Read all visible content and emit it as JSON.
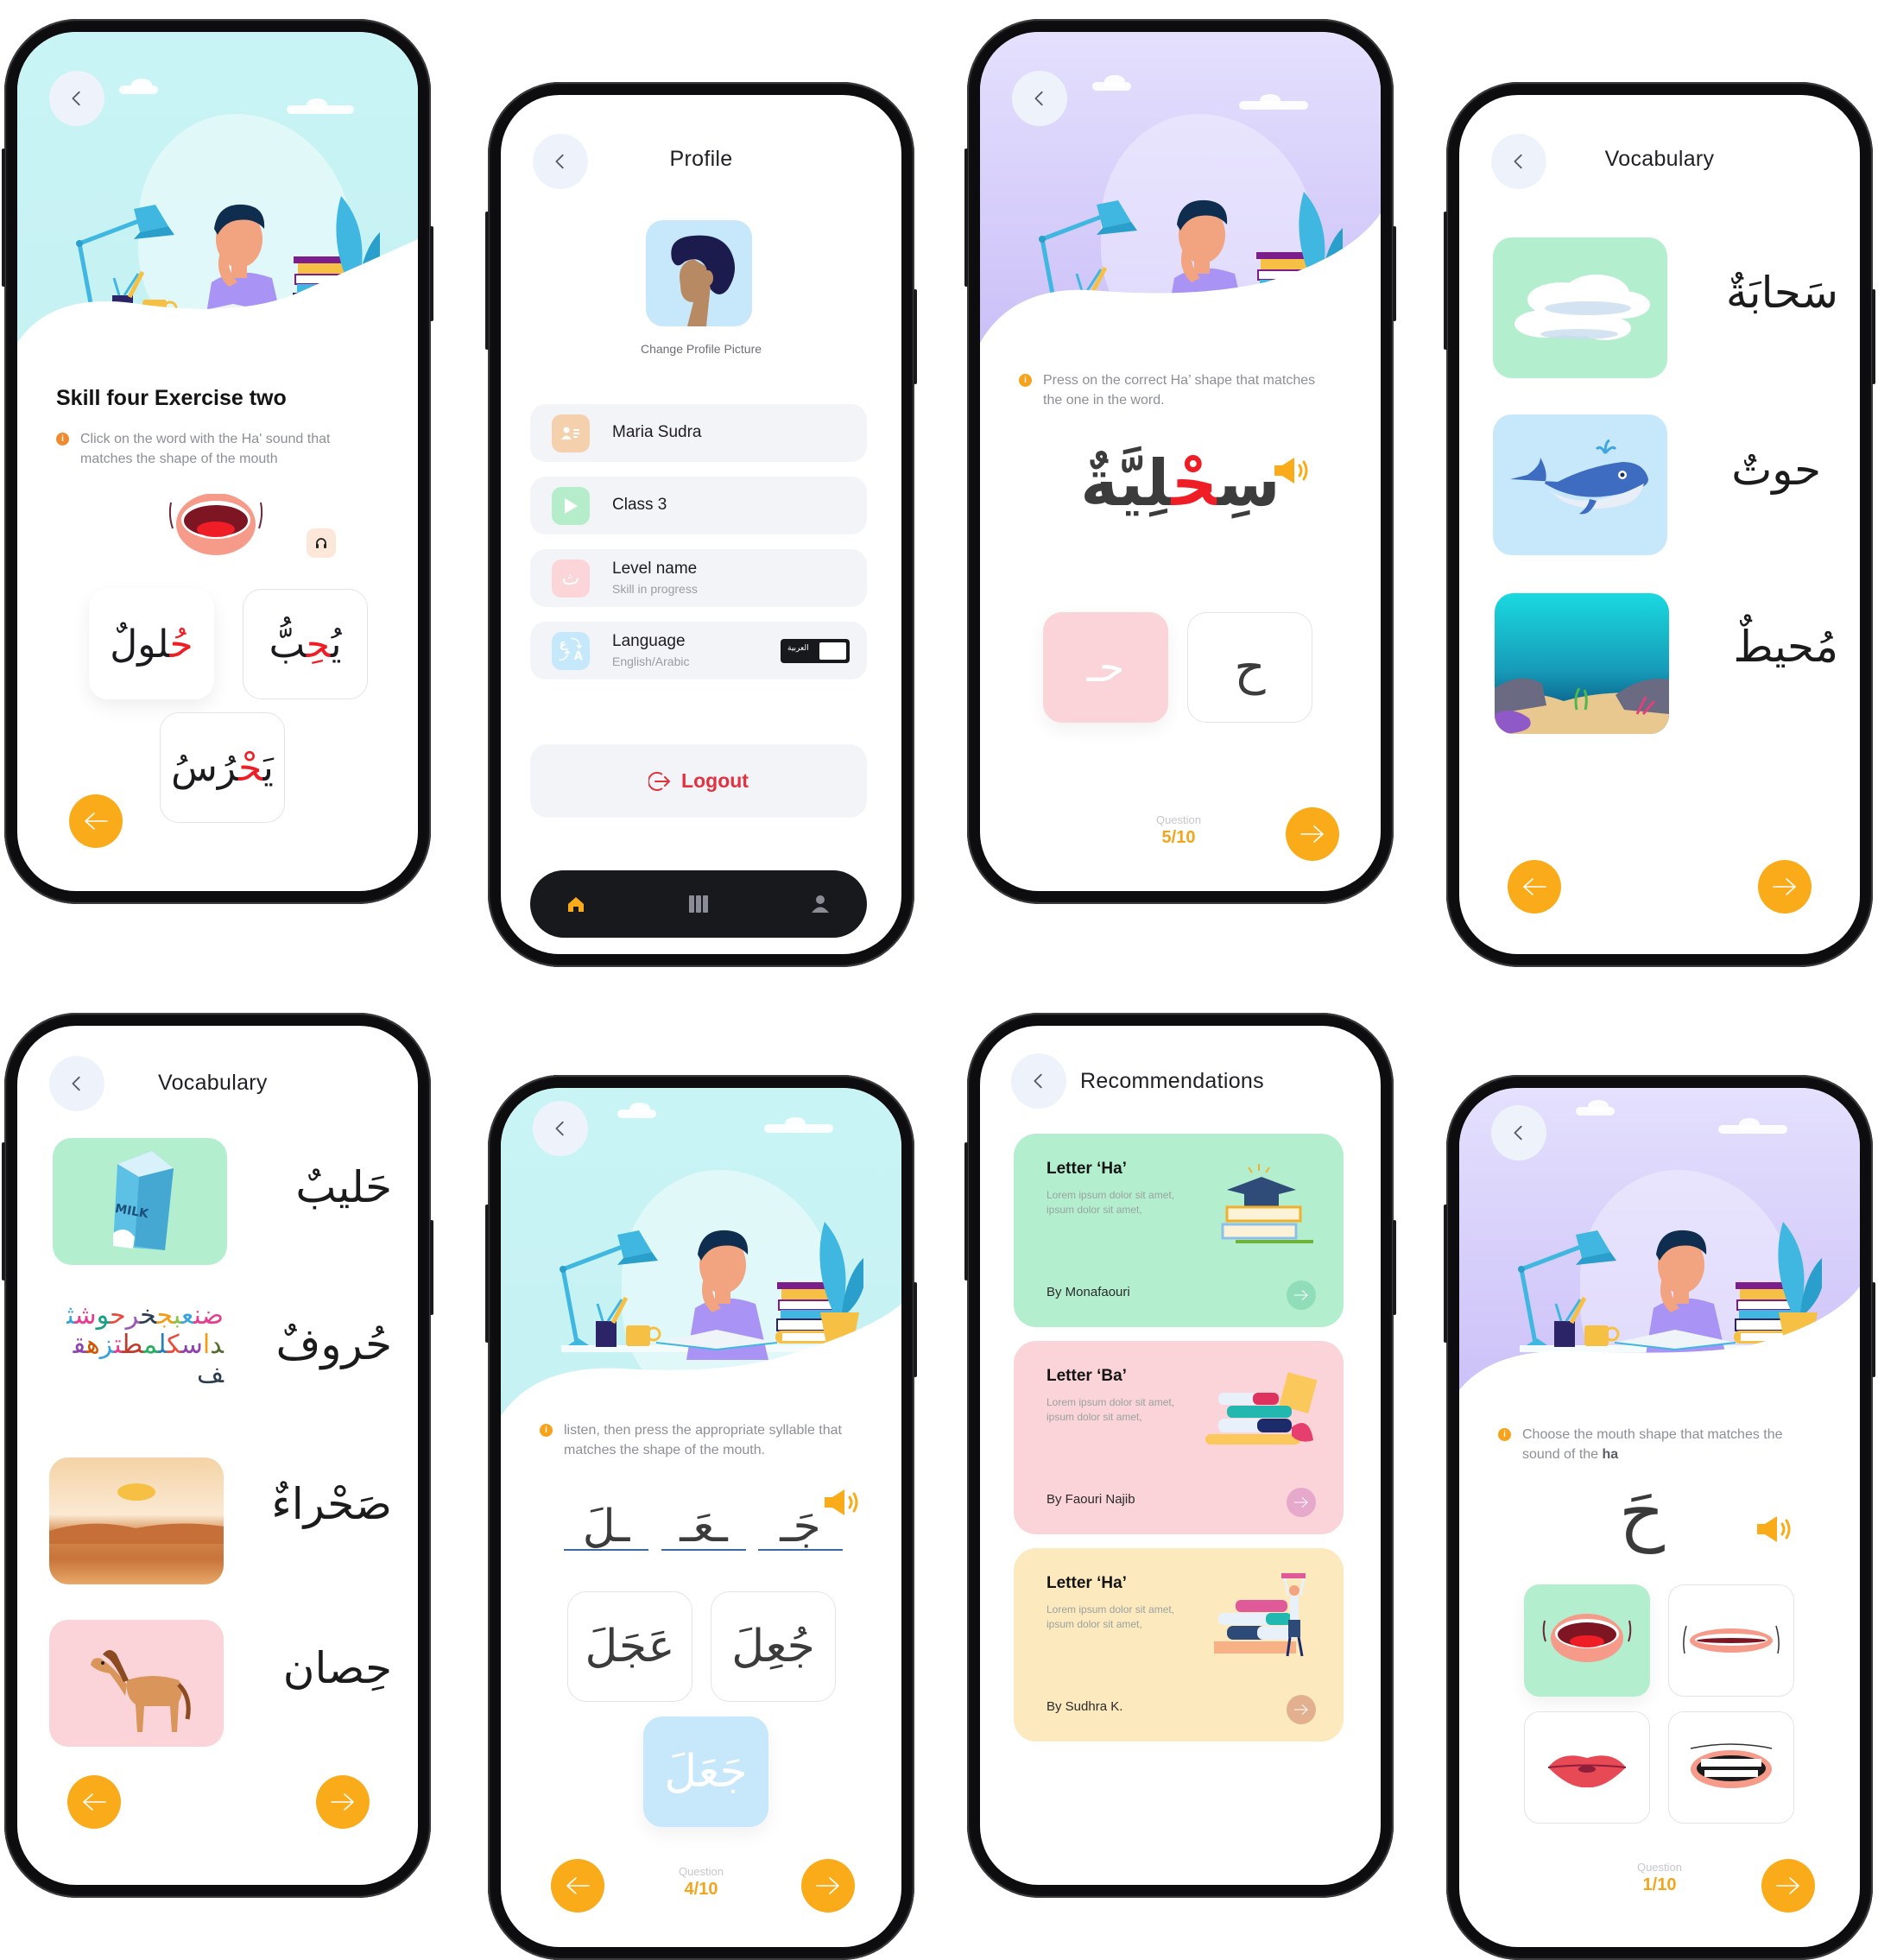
{
  "common": {
    "back_icon": "chevron-left-icon",
    "prev_icon": "arrow-left-icon",
    "next_icon": "arrow-right-icon",
    "speaker_icon": "speaker-icon",
    "info_icon": "info-icon",
    "question_label": "Question",
    "accent_color": "#F9AB1A",
    "highlight_letter_color": "#EF1D25"
  },
  "exercise_words": {
    "title": "Skill four Exercise two",
    "instruction": "Click on the word with the Ha' sound that matches the shape of the mouth",
    "audio_icon": "headphones-icon",
    "mouth_image": "open-mouth-illustration",
    "words": [
      {
        "prefix": "",
        "highlight": "حُ",
        "suffix": "لولٌ"
      },
      {
        "prefix": "يُ",
        "highlight": "حِ",
        "suffix": "بُّ"
      },
      {
        "prefix": "يَ",
        "highlight": "حْ",
        "suffix": "رُسُ"
      }
    ]
  },
  "profile": {
    "title": "Profile",
    "change_picture": "Change Profile Picture",
    "rows": [
      {
        "icon": "contact-card-icon",
        "label": "Maria Sudra",
        "sub": ""
      },
      {
        "icon": "play-icon",
        "label": "Class 3",
        "sub": ""
      },
      {
        "icon": "arabic-letter-icon",
        "label": "Level name",
        "sub": "Skill in progress"
      },
      {
        "icon": "translate-icon",
        "label": "Language",
        "sub": "English/Arabic"
      }
    ],
    "language_toggle_label": "العربية",
    "logout": "Logout",
    "tabs": [
      {
        "name": "home",
        "icon": "home-icon",
        "active": true
      },
      {
        "name": "library",
        "icon": "library-icon",
        "active": false
      },
      {
        "name": "profile",
        "icon": "user-icon",
        "active": false
      }
    ]
  },
  "exercise_shape": {
    "instruction": "Press on the correct Ha’ shape that matches the one in the word.",
    "word": {
      "prefix": "سِ",
      "highlight": "حْ",
      "suffix": "لِيَّةٌ"
    },
    "options": [
      {
        "glyph": "حـ",
        "state": "selected-wrong"
      },
      {
        "glyph": "ح",
        "state": "default"
      }
    ],
    "question": "5/10"
  },
  "vocab_a": {
    "title": "Vocabulary",
    "items": [
      {
        "word": "سَحابَةٌ",
        "image": "clouds"
      },
      {
        "word": "حوتٌ",
        "image": "whale"
      },
      {
        "word": "مُحيطٌ",
        "image": "ocean"
      }
    ]
  },
  "vocab_b": {
    "title": "Vocabulary",
    "items": [
      {
        "word": "حَليبٌ",
        "image": "milk-carton"
      },
      {
        "word": "حُروفٌ",
        "image": "arabic-letters"
      },
      {
        "word": "صَحْراءٌ",
        "image": "desert"
      },
      {
        "word": "حِصان",
        "image": "horse"
      }
    ]
  },
  "exercise_syllables": {
    "instruction": "listen, then press the appropriate syllable that matches the shape of the mouth.",
    "syllables": [
      "جَـ",
      "ـعَـ",
      "ـلَ"
    ],
    "options": [
      {
        "word": "جُعِلَ",
        "state": "default"
      },
      {
        "word": "عَجَلَ",
        "state": "default"
      },
      {
        "word": "جَعَلَ",
        "state": "selected"
      }
    ],
    "question": "4/10"
  },
  "recommendations": {
    "title": "Recommendations",
    "cards": [
      {
        "title": "Letter ‘Ha’",
        "desc": "Lorem ipsum dolor sit amet, ipsum dolor sit amet,",
        "author": "By Monafaouri",
        "bg": "#B3EFCF",
        "btn": "#8FDDB9",
        "image": "graduation-books"
      },
      {
        "title": "Letter ‘Ba’",
        "desc": "Lorem ipsum dolor sit amet, ipsum dolor sit amet,",
        "author": "By Faouri Najib",
        "bg": "#FAD4D8",
        "btn": "#E6A9CC",
        "image": "book-stack"
      },
      {
        "title": "Letter ‘Ha’",
        "desc": "Lorem ipsum dolor sit amet, ipsum dolor sit amet,",
        "author": "By Sudhra K.",
        "bg": "#FDE9BE",
        "btn": "#E2B08F",
        "image": "student-books"
      }
    ]
  },
  "exercise_mouth": {
    "instruction_prefix": "Choose the mouth shape that matches the sound of the ",
    "instruction_bold": "ha",
    "letter": "حَ",
    "options": [
      {
        "image": "wide-open-mouth",
        "state": "selected"
      },
      {
        "image": "smile-mouth",
        "state": "default"
      },
      {
        "image": "closed-lips",
        "state": "default"
      },
      {
        "image": "teeth-mouth",
        "state": "default"
      }
    ],
    "question": "1/10"
  }
}
